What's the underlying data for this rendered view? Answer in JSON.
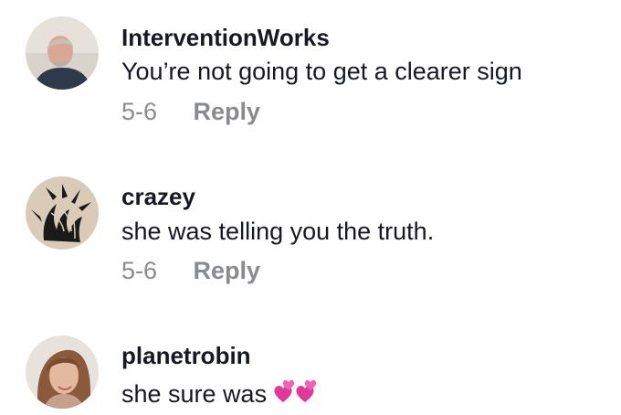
{
  "comments": [
    {
      "username": "InterventionWorks",
      "text": "You’re not going to get a clearer sign",
      "date": "5-6",
      "reply_label": "Reply",
      "avatar_icon": "man-portrait-avatar"
    },
    {
      "username": "crazey",
      "text": "she was telling you the truth.",
      "date": "5-6",
      "reply_label": "Reply",
      "avatar_icon": "dragon-drawing-avatar"
    },
    {
      "username": "planetrobin",
      "text": "she sure was",
      "emoji": "two-hearts-emoji-pair",
      "avatar_icon": "woman-portrait-avatar"
    }
  ],
  "colors": {
    "text": "#161823",
    "muted": "#8a8b91",
    "heart": "#e0399a"
  }
}
